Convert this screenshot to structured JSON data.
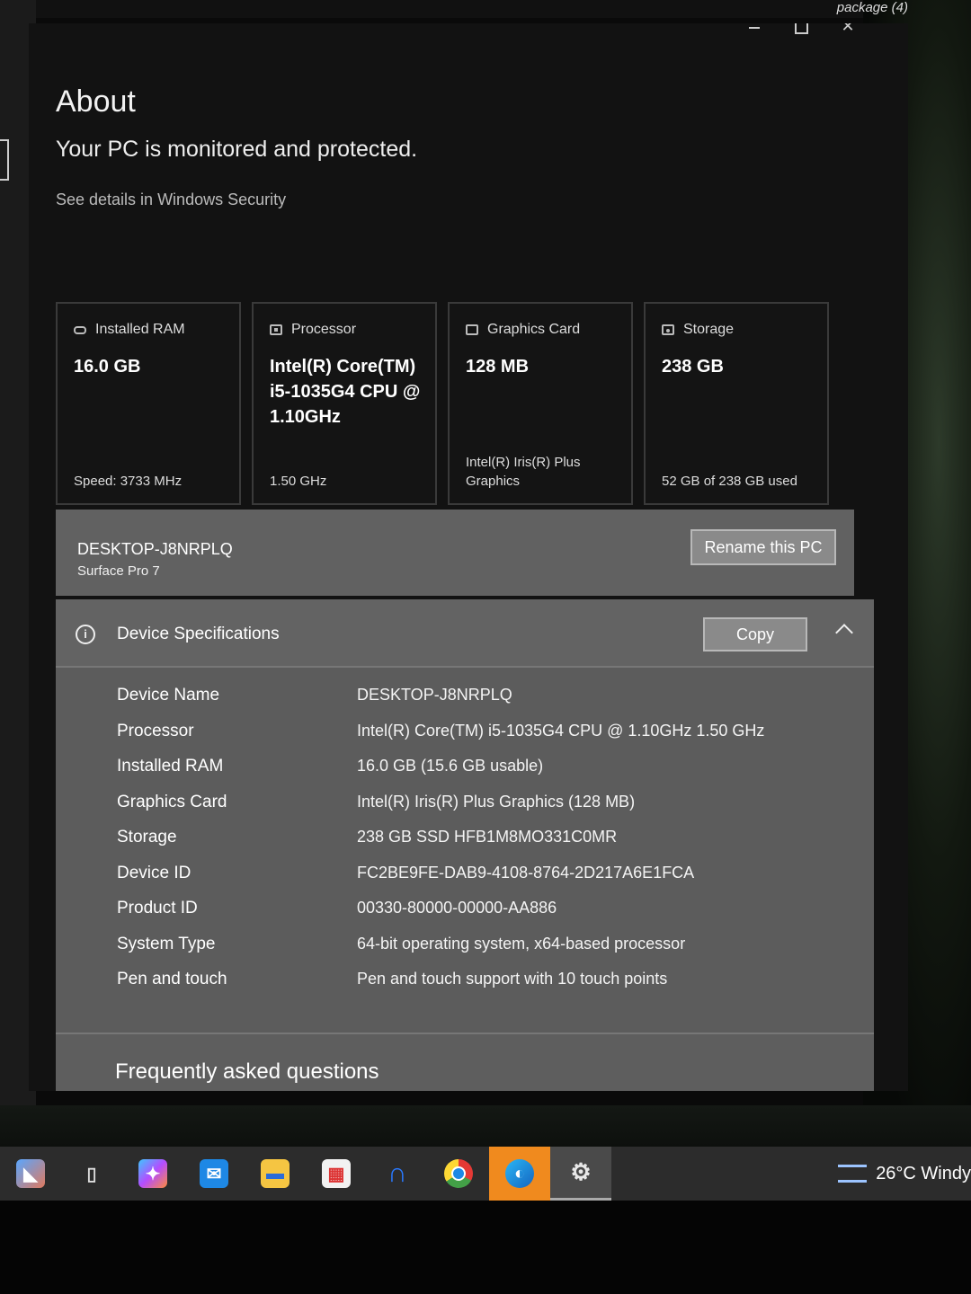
{
  "top_right_label": "package (4)",
  "window": {
    "minimize": "–",
    "maximize": "",
    "close": "✕"
  },
  "about": {
    "title": "About",
    "protection": "Your PC is monitored and protected.",
    "security_link": "See details in Windows Security"
  },
  "cards": [
    {
      "icon": "ram-icon",
      "label": "Installed RAM",
      "value": "16.0 GB",
      "sub": "Speed: 3733 MHz"
    },
    {
      "icon": "processor-icon",
      "label": "Processor",
      "value": "Intel(R) Core(TM) i5-1035G4 CPU @ 1.10GHz",
      "sub": "1.50 GHz"
    },
    {
      "icon": "graphics-card-icon",
      "label": "Graphics Card",
      "value": "128 MB",
      "sub": "Intel(R) Iris(R) Plus Graphics"
    },
    {
      "icon": "storage-icon",
      "label": "Storage",
      "value": "238 GB",
      "sub": "52 GB of 238 GB used"
    }
  ],
  "pc": {
    "name": "DESKTOP-J8NRPLQ",
    "model": "Surface Pro 7",
    "rename_label": "Rename this PC"
  },
  "specs": {
    "title": "Device Specifications",
    "copy_label": "Copy",
    "rows": [
      {
        "label": "Device Name",
        "value": "DESKTOP-J8NRPLQ"
      },
      {
        "label": "Processor",
        "value": "Intel(R) Core(TM) i5-1035G4 CPU @ 1.10GHz   1.50 GHz"
      },
      {
        "label": "Installed RAM",
        "value": "16.0 GB (15.6 GB usable)"
      },
      {
        "label": "Graphics Card",
        "value": "Intel(R) Iris(R) Plus Graphics (128 MB)"
      },
      {
        "label": "Storage",
        "value": "238 GB SSD HFB1M8MO331C0MR"
      },
      {
        "label": "Device ID",
        "value": "FC2BE9FE-DAB9-4108-8764-2D217A6E1FCA"
      },
      {
        "label": "Product ID",
        "value": "00330-80000-00000-AA886"
      },
      {
        "label": "System Type",
        "value": "64-bit operating system, x64-based processor"
      },
      {
        "label": "Pen and touch",
        "value": "Pen and touch support with 10 touch points"
      }
    ]
  },
  "faq": {
    "title": "Frequently asked questions"
  },
  "taskbar": {
    "apps": [
      {
        "name": "widgets-icon",
        "color": "#3a7bd5"
      },
      {
        "name": "task-view-icon",
        "color": "#555555"
      },
      {
        "name": "copilot-icon",
        "color": "#7b5cff"
      },
      {
        "name": "mail-icon",
        "color": "#1e88e5"
      },
      {
        "name": "file-explorer-icon",
        "color": "#f5c542"
      },
      {
        "name": "microsoft-store-icon",
        "color": "#ffffff"
      },
      {
        "name": "onenote-icon",
        "color": "#2979ff"
      },
      {
        "name": "chrome-icon",
        "color": "#e53935"
      },
      {
        "name": "firefox-icon",
        "color": "#1565c0"
      },
      {
        "name": "settings-icon",
        "color": "#cccccc"
      }
    ],
    "weather": "26°C  Windy"
  }
}
